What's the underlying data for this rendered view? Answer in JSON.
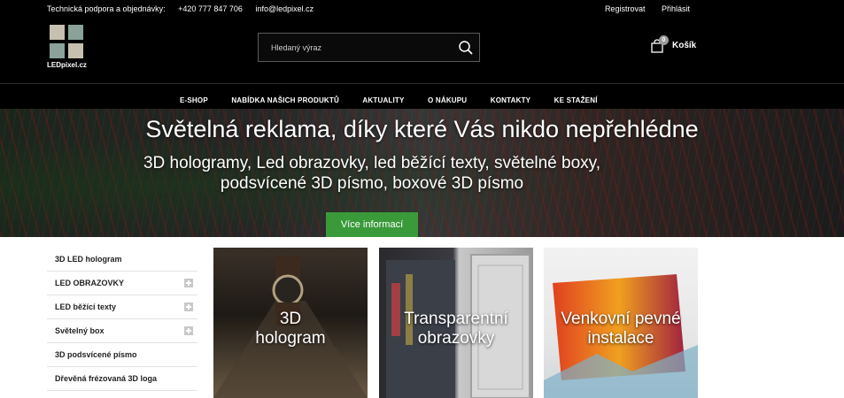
{
  "topbar": {
    "support_label": "Technická podpora a objednávky:",
    "phone": "+420 777 847 706",
    "email": "info@ledpixel.cz",
    "register": "Registrovat",
    "login": "Přihlásit"
  },
  "logo": {
    "text": "LEDpixel.cz",
    "colors": [
      "#c8c0ae",
      "#8aa29a",
      "#8aa29a",
      "#c8c0ae"
    ]
  },
  "search": {
    "placeholder": "Hledaný výraz",
    "value": ""
  },
  "cart": {
    "count": "0",
    "label": "Košík"
  },
  "nav": {
    "items": [
      {
        "label": "E-SHOP"
      },
      {
        "label": "NABÍDKA NAŠICH PRODUKTŮ"
      },
      {
        "label": "AKTUALITY"
      },
      {
        "label": "O NÁKUPU"
      },
      {
        "label": "KONTAKTY"
      },
      {
        "label": "KE STAŽENÍ"
      }
    ]
  },
  "hero": {
    "title": "Světelná reklama, díky které Vás nikdo nepřehlédne",
    "subtitle_line1": "3D hologramy, Led obrazovky, led běžící texty, světelné boxy,",
    "subtitle_line2": "podsvícené 3D písmo, boxové 3D písmo",
    "button": "Více informací"
  },
  "sidebar": {
    "items": [
      {
        "label": "3D LED hologram"
      },
      {
        "label": "LED OBRAZOVKY"
      },
      {
        "label": "LED běžící texty"
      },
      {
        "label": "Světelný box"
      },
      {
        "label": "3D podsvícené písmo"
      },
      {
        "label": "Dřevěná frézovaná 3D loga"
      }
    ]
  },
  "tiles": [
    {
      "line1": "3D",
      "line2": "hologram"
    },
    {
      "line1": "Transparentní",
      "line2": "obrazovky"
    },
    {
      "line1": "Venkovní pevné",
      "line2": "instalace"
    }
  ],
  "colors": {
    "header_bg": "#000000",
    "accent_green": "#3a9a3a"
  }
}
